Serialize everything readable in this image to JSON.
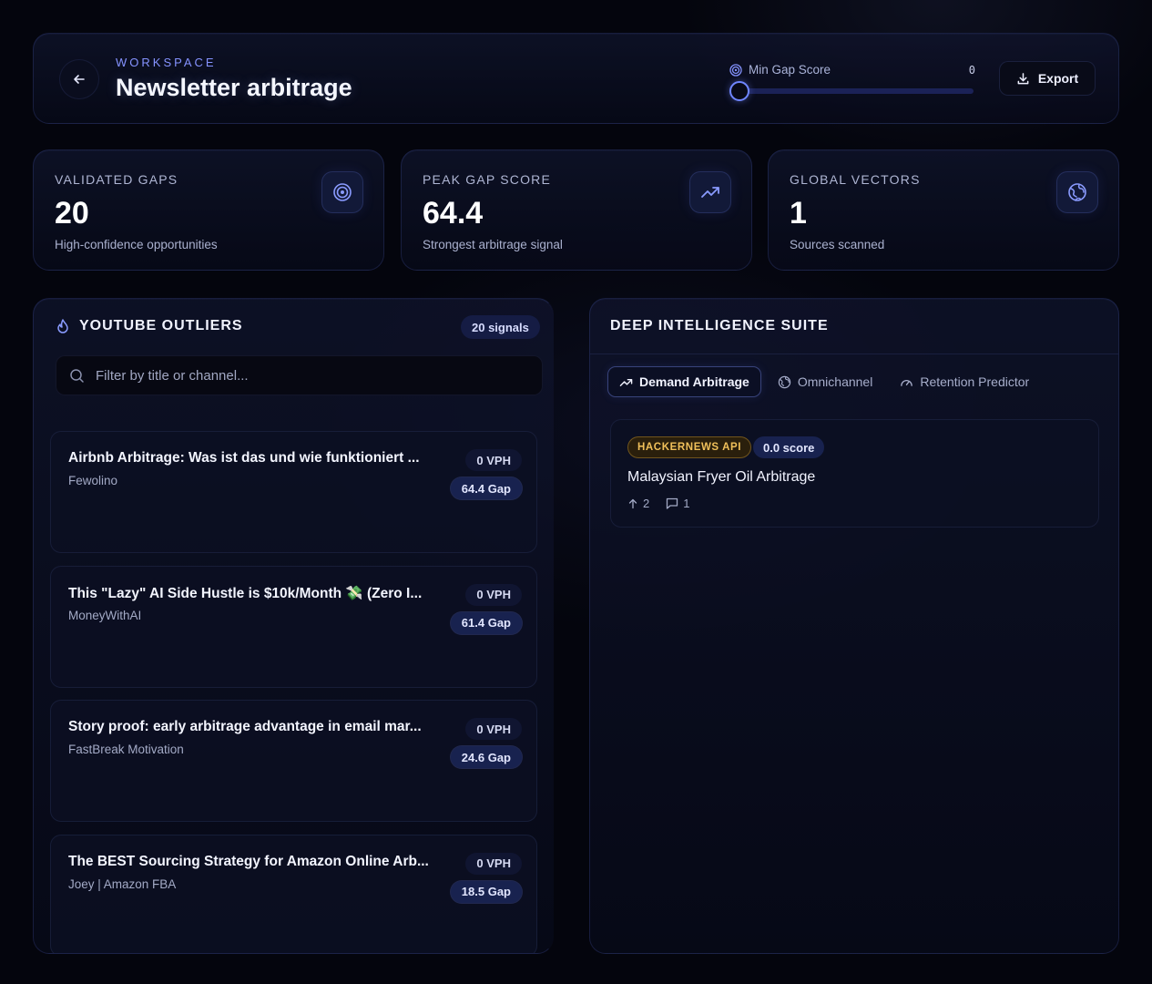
{
  "header": {
    "eyebrow": "WORKSPACE",
    "title": "Newsletter arbitrage",
    "slider_label": "Min Gap Score",
    "slider_value": "0",
    "slider_fraction": 0,
    "export_label": "Export"
  },
  "stats": [
    {
      "label": "VALIDATED GAPS",
      "value": "20",
      "sub": "High-confidence opportunities",
      "icon": "target-icon"
    },
    {
      "label": "PEAK GAP SCORE",
      "value": "64.4",
      "sub": "Strongest arbitrage signal",
      "icon": "trending-up-icon"
    },
    {
      "label": "GLOBAL VECTORS",
      "value": "1",
      "sub": "Sources scanned",
      "icon": "globe-icon"
    }
  ],
  "outliers": {
    "title": "YOUTUBE OUTLIERS",
    "count_badge": "20 signals",
    "search_placeholder": "Filter by title or channel...",
    "items": [
      {
        "title": "Airbnb Arbitrage: Was ist das und wie funktioniert ...",
        "channel": "Fewolino",
        "vph": "0 VPH",
        "gap": "64.4 Gap"
      },
      {
        "title": "This \"Lazy\" AI Side Hustle is $10k/Month 💸 (Zero I...",
        "channel": "MoneyWithAI",
        "vph": "0 VPH",
        "gap": "61.4 Gap"
      },
      {
        "title": "Story proof: early arbitrage advantage in email mar...",
        "channel": "FastBreak Motivation",
        "vph": "0 VPH",
        "gap": "24.6 Gap"
      },
      {
        "title": "The BEST Sourcing Strategy for Amazon Online Arb...",
        "channel": "Joey | Amazon FBA",
        "vph": "0 VPH",
        "gap": "18.5 Gap"
      }
    ]
  },
  "deep": {
    "title": "DEEP INTELLIGENCE SUITE",
    "tabs": [
      {
        "label": "Demand Arbitrage",
        "active": true
      },
      {
        "label": "Omnichannel",
        "active": false
      },
      {
        "label": "Retention Predictor",
        "active": false
      }
    ],
    "result": {
      "source": "HACKERNEWS API",
      "score": "0.0 score",
      "title": "Malaysian Fryer Oil Arbitrage",
      "upvotes": "2",
      "comments": "1"
    }
  }
}
